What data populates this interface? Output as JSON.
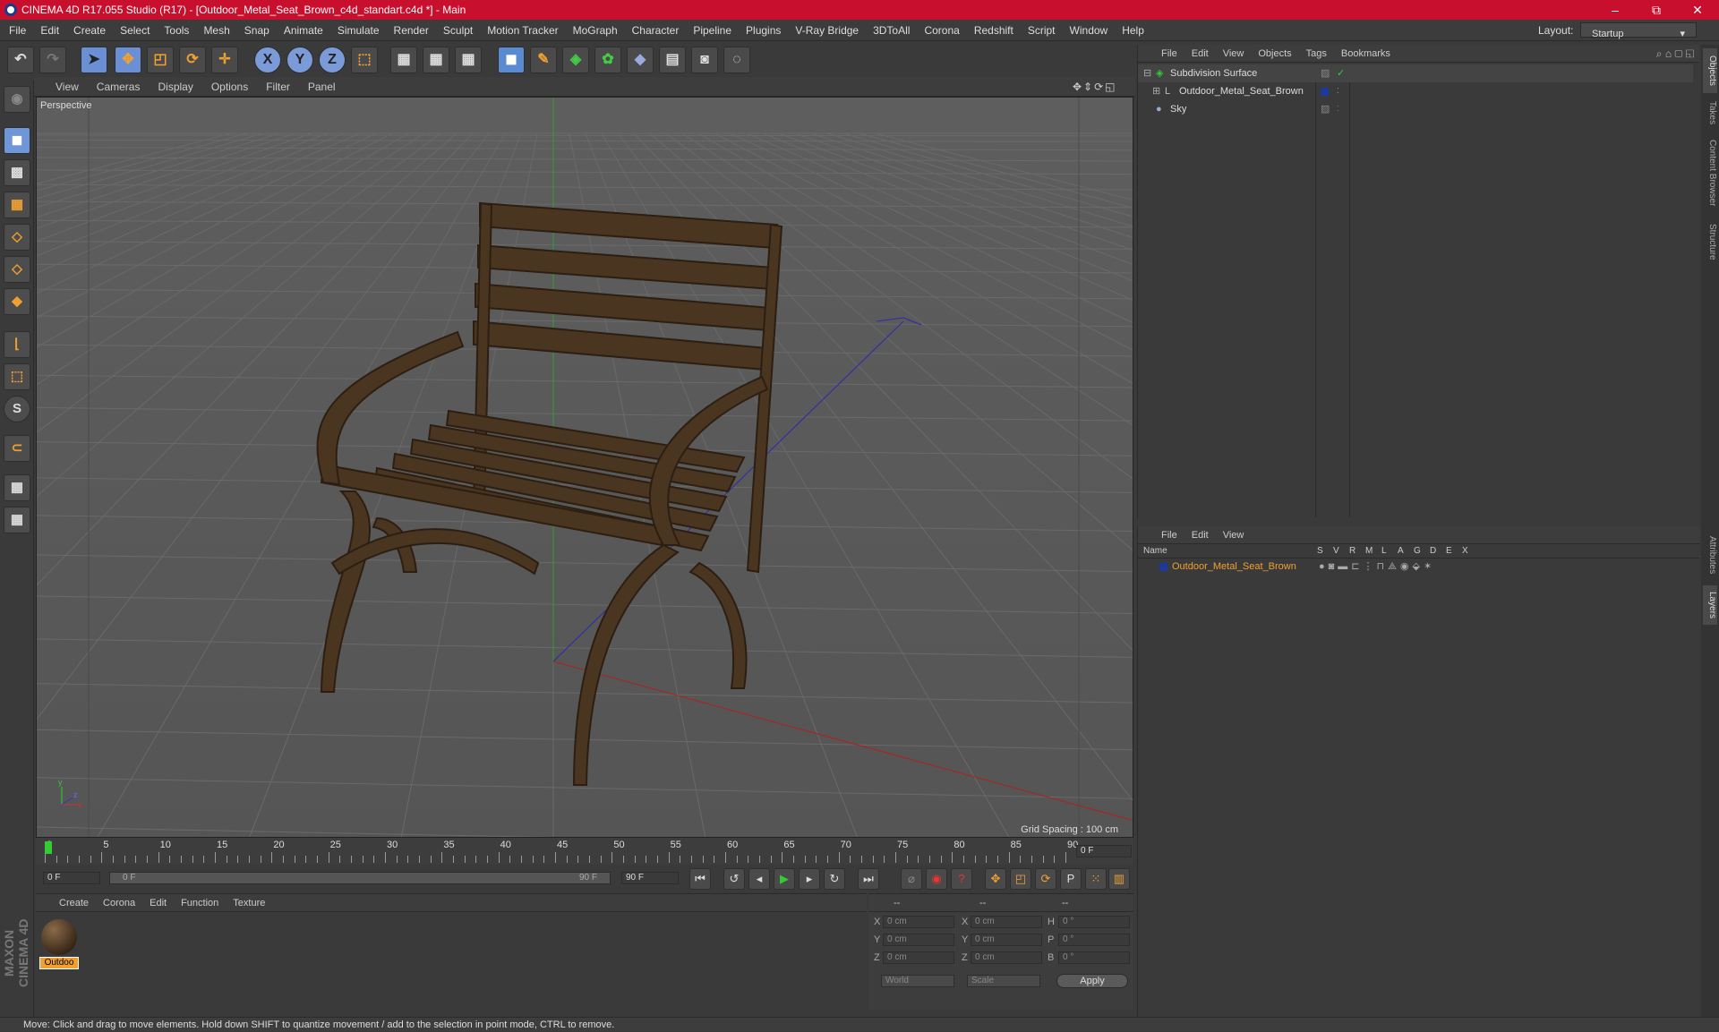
{
  "window": {
    "title": "CINEMA 4D R17.055 Studio (R17) - [Outdoor_Metal_Seat_Brown_c4d_standart.c4d *] - Main",
    "minimize": "–",
    "maximize": "⧉",
    "close": "✕"
  },
  "menu": [
    "File",
    "Edit",
    "Create",
    "Select",
    "Tools",
    "Mesh",
    "Snap",
    "Animate",
    "Simulate",
    "Render",
    "Sculpt",
    "Motion Tracker",
    "MoGraph",
    "Character",
    "Pipeline",
    "Plugins",
    "V-Ray Bridge",
    "3DToAll",
    "Corona",
    "Redshift",
    "Script",
    "Window",
    "Help"
  ],
  "layout": {
    "label": "Layout:",
    "value": "Startup"
  },
  "toolbar": {
    "x": "X",
    "y": "Y",
    "z": "Z"
  },
  "viewport": {
    "menu": [
      "View",
      "Cameras",
      "Display",
      "Options",
      "Filter",
      "Panel"
    ],
    "camera_label": "Perspective",
    "grid_spacing": "Grid Spacing : 100 cm"
  },
  "timeline": {
    "ticks": [
      "0",
      "5",
      "10",
      "15",
      "20",
      "25",
      "30",
      "35",
      "40",
      "45",
      "50",
      "55",
      "60",
      "65",
      "70",
      "75",
      "80",
      "85",
      "90"
    ],
    "current_frame": "0 F",
    "start": "0 F",
    "range_start": "0 F",
    "range_end": "90 F",
    "end": "90 F"
  },
  "material_panel": {
    "menu": [
      "Create",
      "Corona",
      "Edit",
      "Function",
      "Texture"
    ],
    "material_name": "Outdoo"
  },
  "coords": {
    "headers": [
      "--",
      "--",
      "--"
    ],
    "rows": [
      {
        "a": "X",
        "av": "0 cm",
        "b": "X",
        "bv": "0 cm",
        "c": "H",
        "cv": "0 °"
      },
      {
        "a": "Y",
        "av": "0 cm",
        "b": "Y",
        "bv": "0 cm",
        "c": "P",
        "cv": "0 °"
      },
      {
        "a": "Z",
        "av": "0 cm",
        "b": "Z",
        "bv": "0 cm",
        "c": "B",
        "cv": "0 °"
      }
    ],
    "world": "World",
    "scale": "Scale",
    "apply": "Apply"
  },
  "object_manager": {
    "menu": [
      "File",
      "Edit",
      "View",
      "Objects",
      "Tags",
      "Bookmarks"
    ],
    "objects": [
      "Subdivision Surface",
      "Outdoor_Metal_Seat_Brown",
      "Sky"
    ]
  },
  "layer_manager": {
    "menu": [
      "File",
      "Edit",
      "View"
    ],
    "columns": [
      "Name",
      "S",
      "V",
      "R",
      "M",
      "L",
      "A",
      "G",
      "D",
      "E",
      "X"
    ],
    "layer": "Outdoor_Metal_Seat_Brown"
  },
  "side_tabs": [
    "Objects",
    "Takes",
    "Content Browser",
    "Structure",
    "Attributes",
    "Layers"
  ],
  "brand": "MAXON CINEMA 4D",
  "status": "Move: Click and drag to move elements. Hold down SHIFT to quantize movement / add to the selection in point mode, CTRL to remove.",
  "colors": {
    "title_bar": "#c8102e",
    "accent": "#f0a030",
    "selection": "#f0a030",
    "wood": "#4a3520"
  }
}
